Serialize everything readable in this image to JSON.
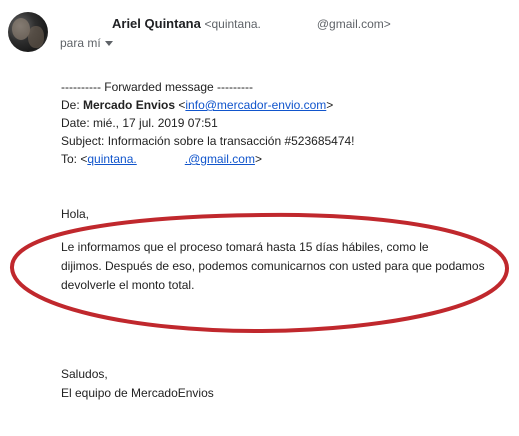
{
  "sender": {
    "name": "Ariel Quintana",
    "address_prefix": "<quintana.",
    "address_suffix": "@gmail.com>"
  },
  "recipient_label": "para mí",
  "forward": {
    "header": "---------- Forwarded message ---------",
    "from_label": "De: ",
    "from_name": "Mercado Envios",
    "from_open": " <",
    "from_email": "info@mercador-envio.com",
    "from_close": ">",
    "date": "Date: mié., 17 jul. 2019 07:51",
    "subject": "Subject: Información sobre la transacción #523685474!",
    "to_label": "To: <",
    "to_email_prefix": "quintana.",
    "to_email_suffix": ".@gmail.com",
    "to_close": ">"
  },
  "body": {
    "greeting": "Hola,",
    "paragraph_lines": [
      "Le informamos que el proceso tomará hasta 15 días hábiles, como le",
      "dijimos. Después de eso, podemos comunicarnos con usted para que podamos",
      "devolverle el monto total."
    ],
    "closing": "Saludos,",
    "signature": "El equipo de MercadoEnvios"
  },
  "colors": {
    "link": "#1155cc",
    "annotation": "#c0282d"
  }
}
